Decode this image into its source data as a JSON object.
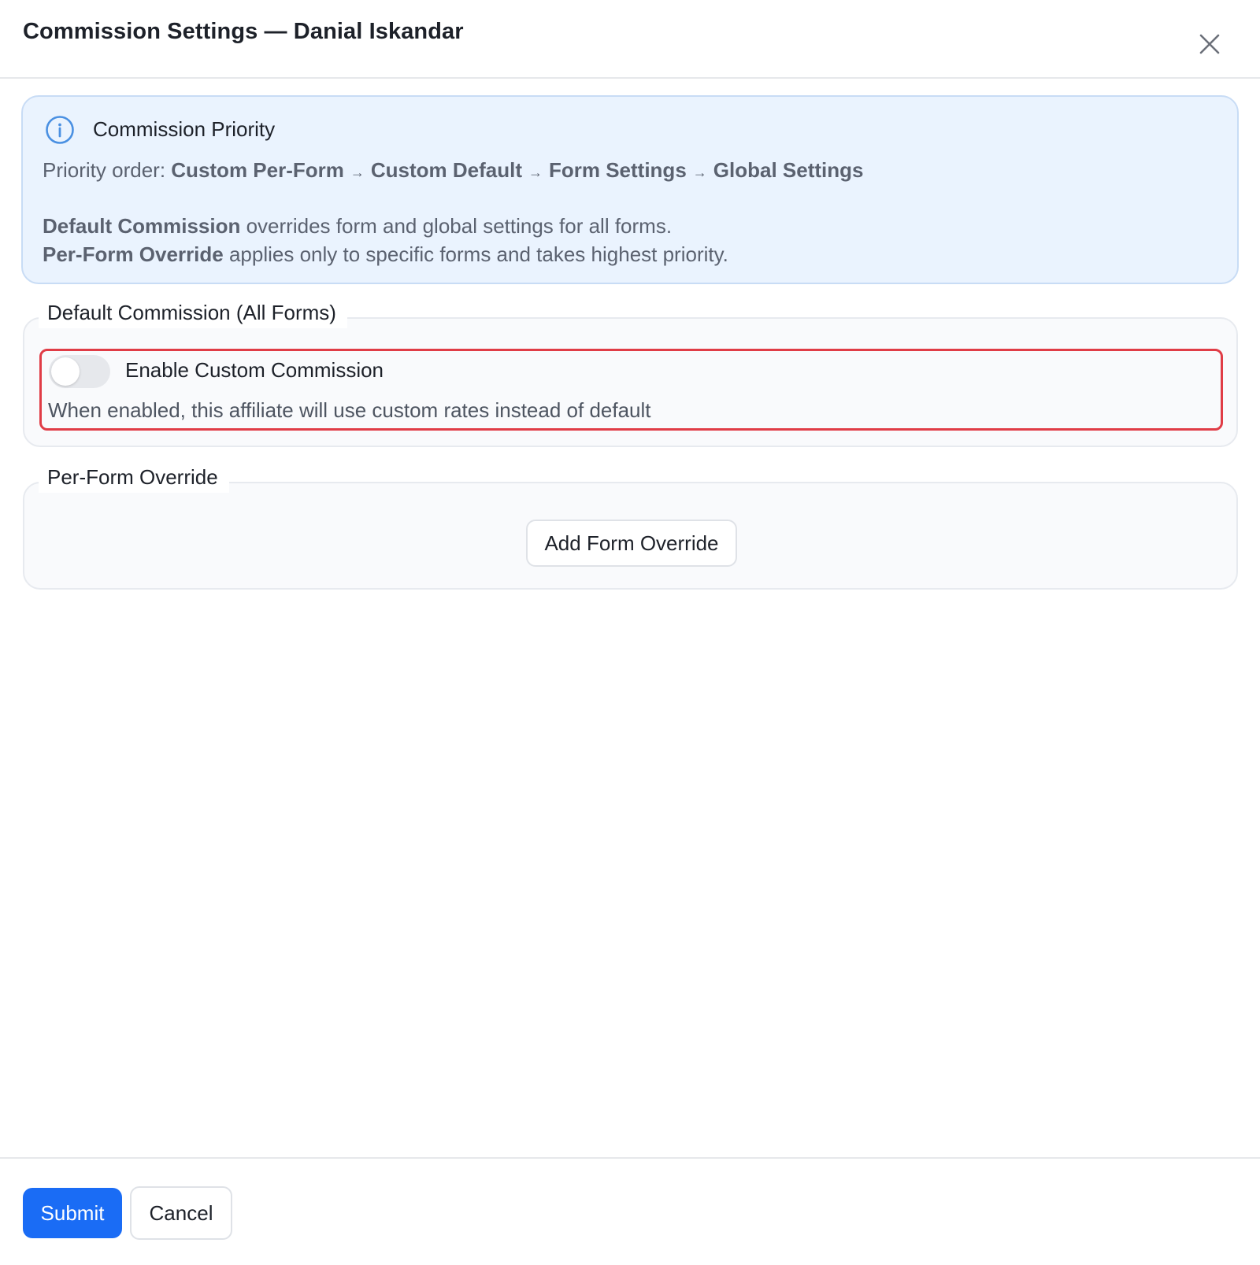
{
  "header": {
    "title": "Commission Settings — Danial Iskandar",
    "close_icon": "close-icon"
  },
  "info": {
    "icon": "info-icon",
    "heading": "Commission Priority",
    "priority_prefix": "Priority order:",
    "priority_items": [
      "Custom Per-Form",
      "Custom Default",
      "Form Settings",
      "Global Settings"
    ],
    "arrow": "→",
    "default_bold": "Default Commission",
    "default_text": " overrides form and global settings for all forms.",
    "perform_bold": "Per-Form Override",
    "perform_text": " applies only to specific forms and takes highest priority."
  },
  "default_section": {
    "legend": "Default Commission (All Forms)",
    "toggle_label": "Enable Custom Commission",
    "toggle_enabled": false,
    "toggle_help": "When enabled, this affiliate will use custom rates instead of default",
    "highlight_color": "#e03c46"
  },
  "perform_section": {
    "legend": "Per-Form Override",
    "add_button": "Add Form Override"
  },
  "footer": {
    "submit": "Submit",
    "cancel": "Cancel"
  },
  "colors": {
    "primary": "#1a6cf5",
    "info_bg": "#eaf3fe",
    "info_icon": "#4a90e2"
  }
}
